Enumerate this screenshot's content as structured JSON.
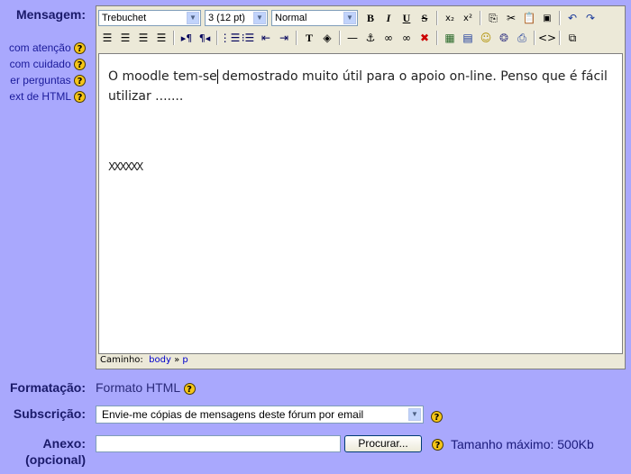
{
  "labels": {
    "message": "Mensagem:",
    "formatting": "Formatação:",
    "subscription": "Subscrição:",
    "attachment": "Anexo:",
    "attachment_optional": "(opcional)"
  },
  "help_links": [
    {
      "label": "com atenção"
    },
    {
      "label": "com cuidado"
    },
    {
      "label": "er perguntas"
    },
    {
      "label": "ext de HTML"
    }
  ],
  "toolbar": {
    "font_family": "Trebuchet",
    "font_size": "3 (12 pt)",
    "paragraph_style": "Normal",
    "bold": "B",
    "italic": "I",
    "underline": "U",
    "strikethrough": "S"
  },
  "editor": {
    "paragraph1_before_caret": "O moodle tem-se",
    "paragraph1_after_caret": " demostrado muito útil para o apoio on-line. Penso que é fácil utilizar .......",
    "paragraph2": "XXXXXX",
    "path_label": "Caminho:",
    "path_body": "body",
    "path_sep": "»",
    "path_p": "p"
  },
  "formatting": {
    "value": "Formato HTML"
  },
  "subscription": {
    "selected": "Envie-me cópias de mensagens deste fórum por email"
  },
  "attachment": {
    "browse_label": "Procurar...",
    "max_size": "Tamanho máximo: 500Kb"
  }
}
